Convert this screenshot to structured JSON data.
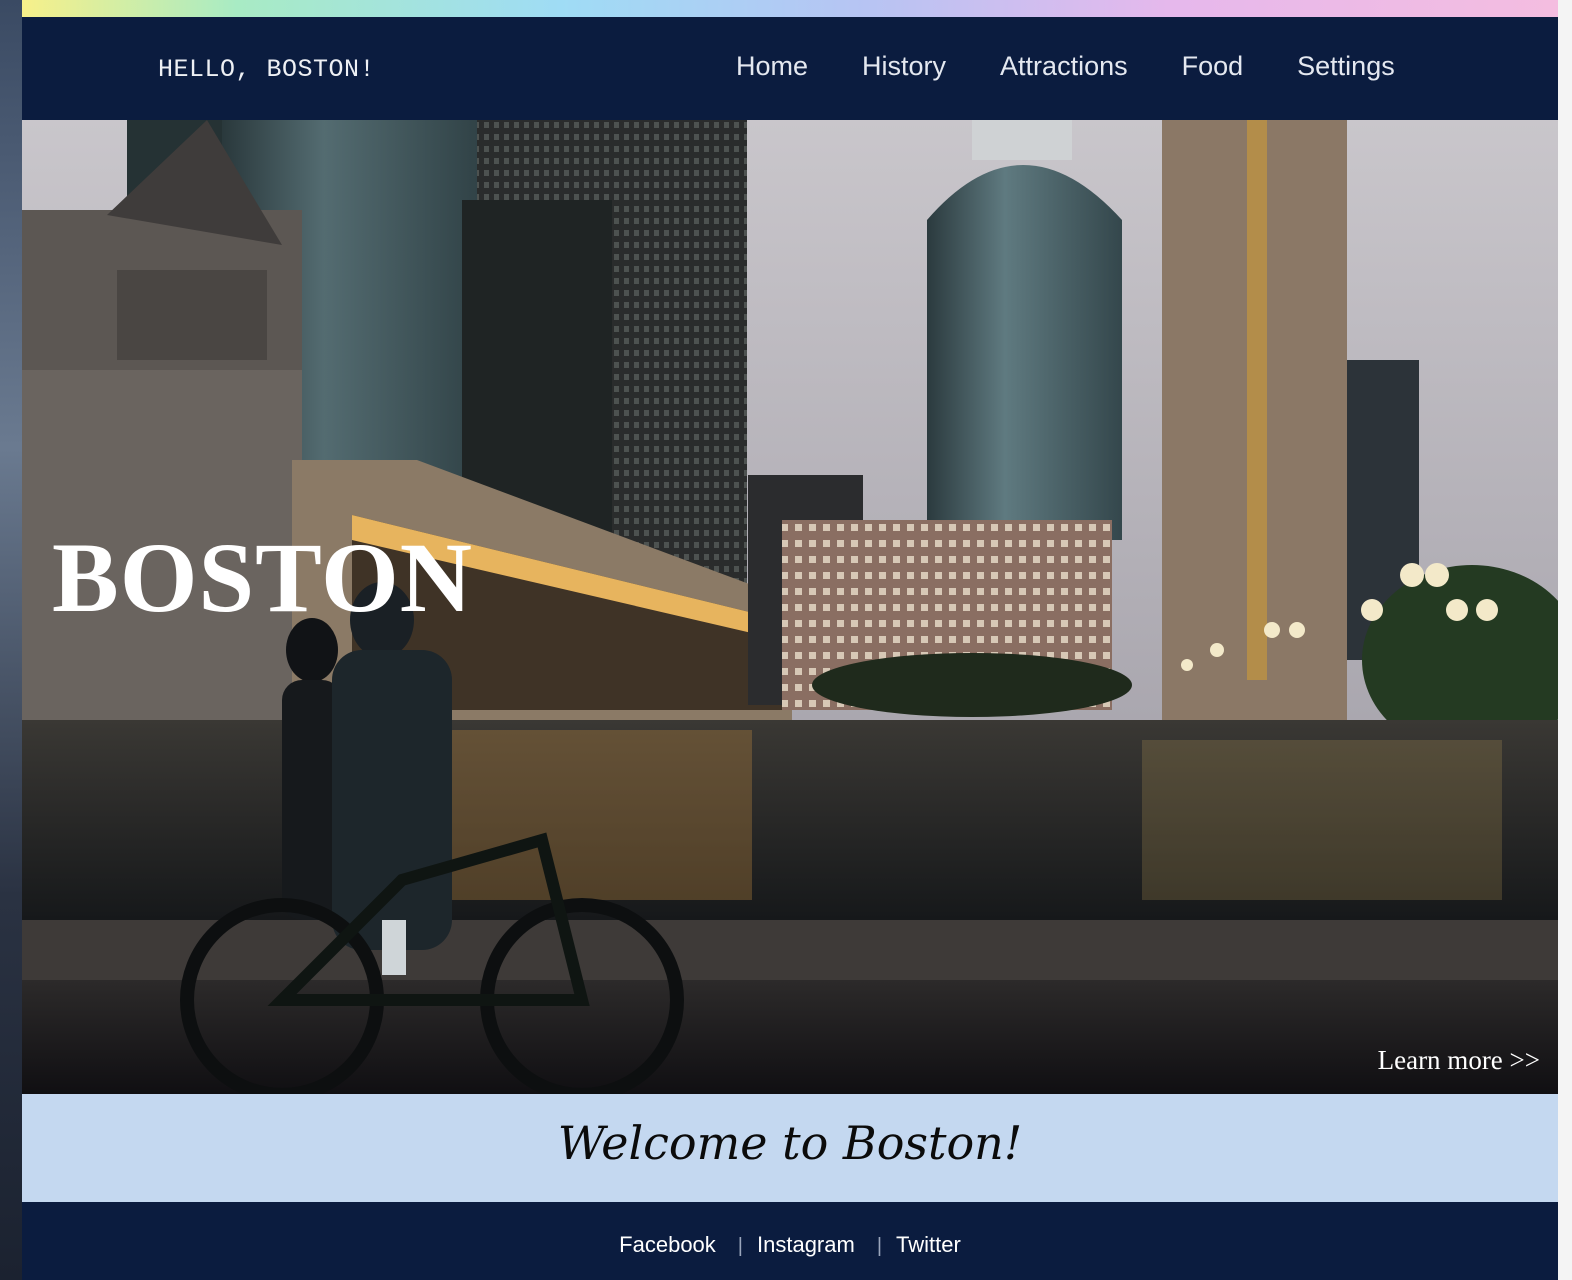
{
  "brand": "HELLO, BOSTON!",
  "nav": {
    "items": [
      "Home",
      "History",
      "Attractions",
      "Food",
      "Settings"
    ]
  },
  "hero": {
    "title": "BOSTON",
    "learn_more": "Learn more >>"
  },
  "welcome": "Welcome to Boston!",
  "footer": {
    "links": [
      "Facebook",
      "Instagram",
      "Twitter"
    ],
    "separator": "|"
  },
  "colors": {
    "navbar_bg": "#0b1c3f",
    "welcome_bg": "#c4d8f0",
    "footer_bg": "#0b1c3f",
    "text_light": "#ffffff"
  },
  "icons": [
    "city-skyline-photo"
  ]
}
